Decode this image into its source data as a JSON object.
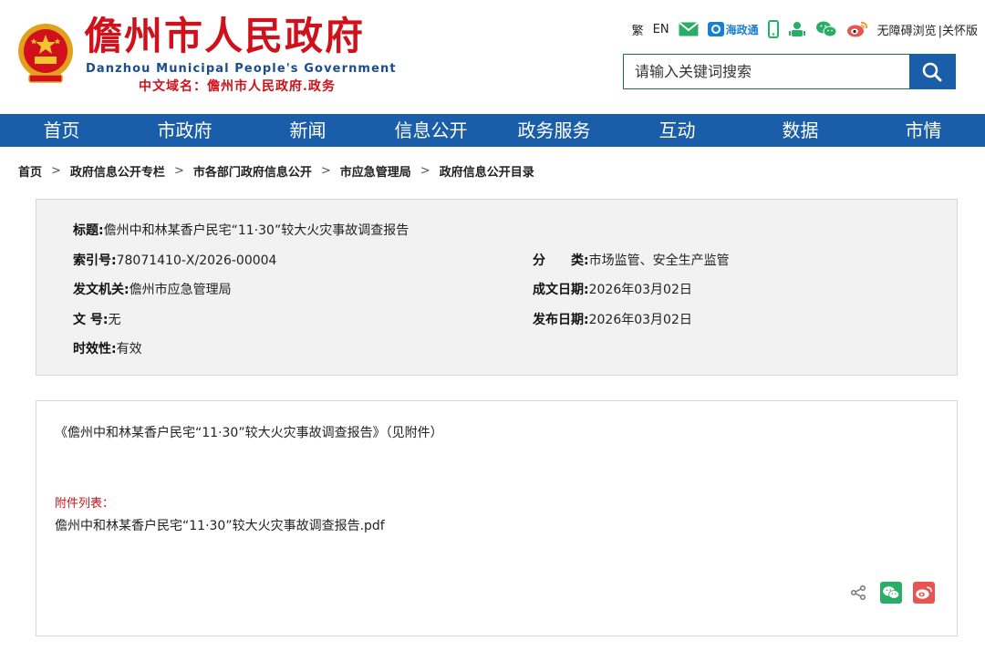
{
  "header": {
    "title": "儋州市人民政府",
    "title_en": "Danzhou Municipal People's Government",
    "domain": "中文域名：儋州市人民政府.政务",
    "toolbar": {
      "traditional": "繁",
      "english": "EN",
      "haizhengtong": "海政通",
      "accessible": "无障碍浏览",
      "care": "|关怀版"
    },
    "search": {
      "placeholder": "请输入关键词搜索"
    }
  },
  "nav": {
    "items": [
      {
        "label": "首页"
      },
      {
        "label": "市政府"
      },
      {
        "label": "新闻"
      },
      {
        "label": "信息公开"
      },
      {
        "label": "政务服务"
      },
      {
        "label": "互动"
      },
      {
        "label": "数据"
      },
      {
        "label": "市情"
      }
    ]
  },
  "breadcrumb": {
    "items": [
      {
        "label": "首页"
      },
      {
        "label": "政府信息公开专栏"
      },
      {
        "label": "市各部门政府信息公开"
      },
      {
        "label": "市应急管理局"
      },
      {
        "label": "政府信息公开目录"
      }
    ],
    "separator": ">"
  },
  "meta": {
    "title_label": "标题:",
    "title_value": "儋州中和林某香户民宅“11·30”较大火灾事故调查报告",
    "index_label": "索引号:",
    "index_value": "78071410-X/2026-00004",
    "category_label": "分　　类:",
    "category_value": "市场监管、安全生产监管",
    "issuer_label": "发文机关:",
    "issuer_value": "儋州市应急管理局",
    "created_label": "成文日期:",
    "created_value": "2026年03月02日",
    "docno_label": "文 号:",
    "docno_value": "无",
    "published_label": "发布日期:",
    "published_value": "2026年03月02日",
    "validity_label": "时效性:",
    "validity_value": "有效"
  },
  "content": {
    "body": "《儋州中和林某香户民宅“11·30”较大火灾事故调查报告》（见附件）",
    "attachments_title": "附件列表：",
    "attachments": [
      {
        "name": "儋州中和林某香户民宅“11·30”较大火灾事故调查报告.pdf"
      }
    ]
  },
  "colors": {
    "brand_red": "#d0111b",
    "brand_blue": "#1a5da8",
    "wechat_green": "#2aae67",
    "weibo_red": "#e8544f"
  }
}
